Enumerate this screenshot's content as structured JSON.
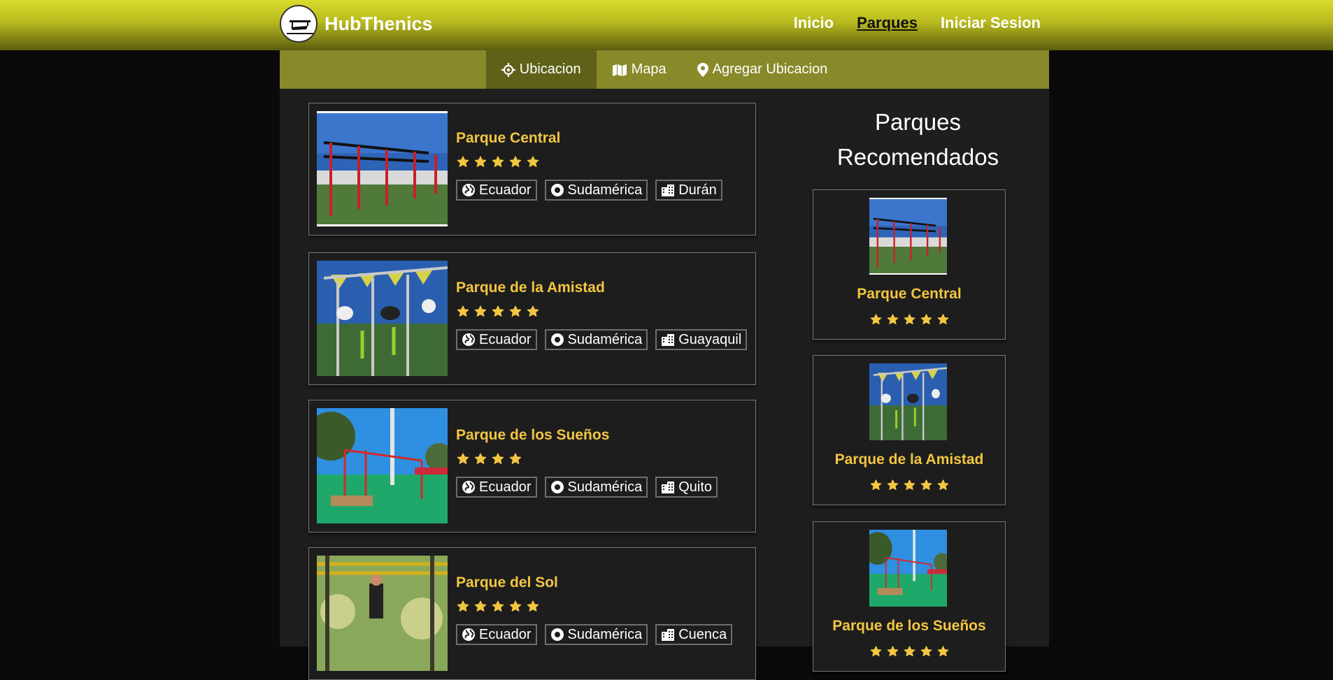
{
  "app": {
    "name": "HubThenics"
  },
  "nav": {
    "items": [
      {
        "label": "Inicio",
        "active": false
      },
      {
        "label": "Parques",
        "active": true
      },
      {
        "label": "Iniciar Sesion",
        "active": false
      }
    ]
  },
  "subnav": {
    "tabs": [
      {
        "label": "Ubicacion",
        "icon": "crosshair-icon",
        "active": true
      },
      {
        "label": "Mapa",
        "icon": "map-icon",
        "active": false
      },
      {
        "label": "Agregar Ubicacion",
        "icon": "map-pin-icon",
        "active": false
      }
    ]
  },
  "parks": [
    {
      "name": "Parque Central",
      "rating": 5,
      "country": "Ecuador",
      "region": "Sudamérica",
      "city": "Durán"
    },
    {
      "name": "Parque de la Amistad",
      "rating": 5,
      "country": "Ecuador",
      "region": "Sudamérica",
      "city": "Guayaquil"
    },
    {
      "name": "Parque de los Sueños",
      "rating": 4,
      "country": "Ecuador",
      "region": "Sudamérica",
      "city": "Quito"
    },
    {
      "name": "Parque del Sol",
      "rating": 5,
      "country": "Ecuador",
      "region": "Sudamérica",
      "city": "Cuenca"
    }
  ],
  "recommended": {
    "title": "Parques Recomendados",
    "items": [
      {
        "name": "Parque Central",
        "rating": 5
      },
      {
        "name": "Parque de la Amistad",
        "rating": 5
      },
      {
        "name": "Parque de los Sueños",
        "rating": 5
      }
    ]
  },
  "colors": {
    "accent": "#f3c640",
    "header": "#d9dc2a",
    "subnav": "#888a2a",
    "subnav_active": "#5f6119"
  }
}
